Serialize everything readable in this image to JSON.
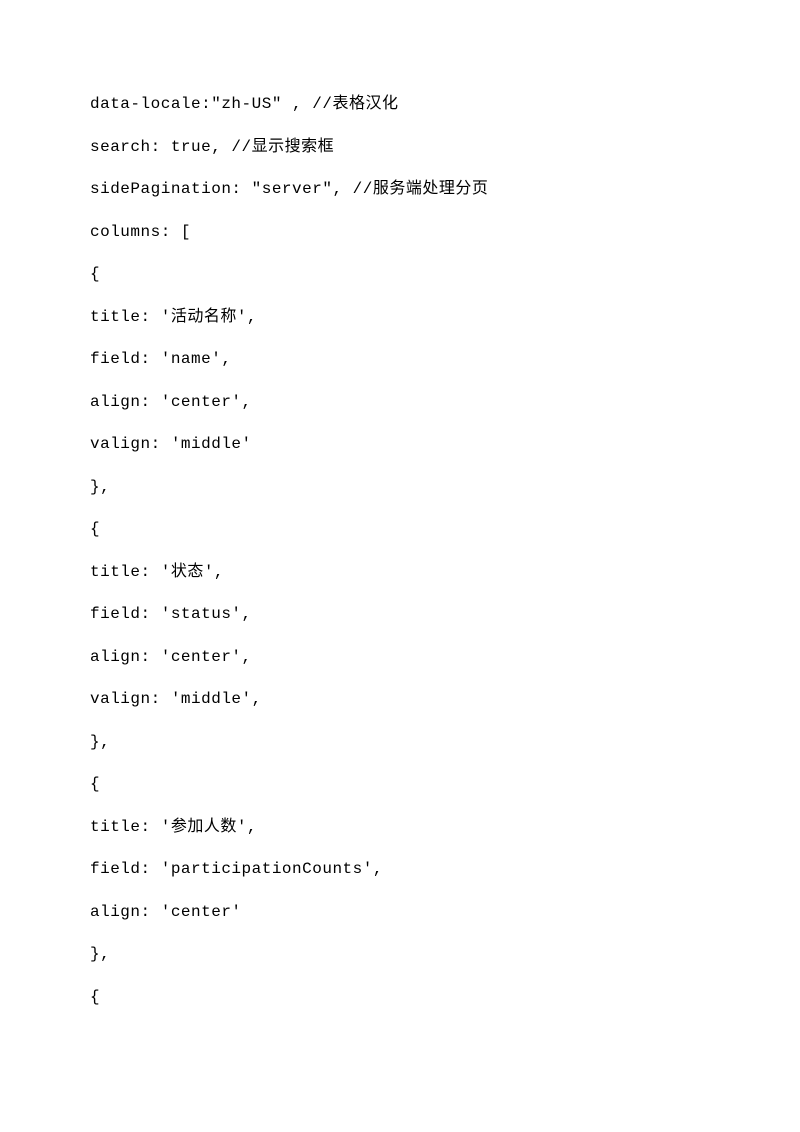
{
  "lines": [
    "data-locale:\"zh-US\" , //表格汉化",
    "search: true, //显示搜索框",
    "sidePagination: \"server\", //服务端处理分页",
    "columns: [",
    "{",
    "title: '活动名称',",
    "field: 'name',",
    "align: 'center',",
    "valign: 'middle'",
    "},",
    "{",
    "title: '状态',",
    "field: 'status',",
    "align: 'center',",
    "valign: 'middle',",
    "},",
    "{",
    "title: '参加人数',",
    "field: 'participationCounts',",
    "align: 'center'",
    "},",
    "{"
  ]
}
